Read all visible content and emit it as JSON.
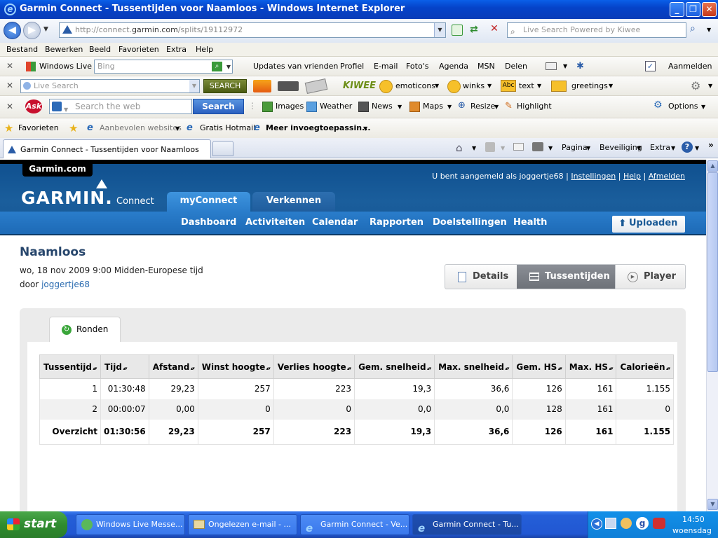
{
  "window": {
    "title": "Garmin Connect - Tussentijden voor Naamloos - Windows Internet Explorer"
  },
  "address": {
    "prefix": "http://connect.",
    "domain": "garmin.com",
    "path": "/splits/19112972",
    "search_placeholder": "Live Search Powered by Kiwee"
  },
  "menu": [
    "Bestand",
    "Bewerken",
    "Beeld",
    "Favorieten",
    "Extra",
    "Help"
  ],
  "toolbar_live": {
    "brand": "Windows Live",
    "search_placeholder": "Bing",
    "links": [
      "Updates van vrienden",
      "Profiel",
      "E-mail",
      "Foto's",
      "Agenda",
      "MSN",
      "Delen"
    ],
    "signin": "Aanmelden"
  },
  "toolbar_kiwee": {
    "search_placeholder": "Live Search",
    "search_button": "SEARCH",
    "brand": "KIWEE",
    "items": [
      "emoticons",
      "winks",
      "text",
      "greetings"
    ]
  },
  "toolbar_ask": {
    "brand": "Ask",
    "search_placeholder": "Search the web",
    "search_button": "Search",
    "items": [
      "Images",
      "Weather",
      "News",
      "Maps",
      "Resize",
      "Highlight"
    ],
    "options": "Options"
  },
  "favorites": {
    "label": "Favorieten",
    "items": [
      "Aanbevolen websites",
      "Gratis Hotmail",
      "Meer invoegtoepassin..."
    ]
  },
  "tab": {
    "label": "Garmin Connect - Tussentijden voor Naamloos"
  },
  "commandbar": [
    "Pagina",
    "Beveiliging",
    "Extra"
  ],
  "garmin": {
    "site_link": "Garmin.com",
    "status_prefix": "U bent aangemeld als joggertje68 |",
    "status_links": [
      "Instellingen",
      "Help",
      "Afmelden"
    ],
    "logo": "GARMIN.",
    "logo_sub": "Connect",
    "main_tabs": [
      "myConnect",
      "Verkennen"
    ],
    "subnav": [
      "Dashboard",
      "Activiteiten",
      "Calendar",
      "Rapporten",
      "Doelstellingen",
      "Health"
    ],
    "upload": "Uploaden"
  },
  "activity": {
    "title": "Naamloos",
    "date": "wo, 18 nov 2009 9:00 Midden-Europese tijd",
    "by_prefix": "door",
    "user": "joggertje68"
  },
  "view_tabs": [
    "Details",
    "Tussentijden",
    "Player"
  ],
  "splits": {
    "tab": "Ronden",
    "headers": [
      "Tussentijd",
      "Tijd",
      "Afstand",
      "Winst hoogte",
      "Verlies hoogte",
      "Gem. snelheid",
      "Max. snelheid",
      "Gem. HS",
      "Max. HS",
      "Calorieën"
    ],
    "rows": [
      [
        "1",
        "01:30:48",
        "29,23",
        "257",
        "223",
        "19,3",
        "36,6",
        "126",
        "161",
        "1.155"
      ],
      [
        "2",
        "00:00:07",
        "0,00",
        "0",
        "0",
        "0,0",
        "0,0",
        "128",
        "161",
        "0"
      ]
    ],
    "total": [
      "Overzicht",
      "01:30:56",
      "29,23",
      "257",
      "223",
      "19,3",
      "36,6",
      "126",
      "161",
      "1.155"
    ]
  },
  "taskbar": {
    "start": "start",
    "tasks": [
      "Windows Live Messe...",
      "Ongelezen e-mail - ...",
      "Garmin Connect - Ve...",
      "Garmin Connect - Tu..."
    ],
    "time": "14:50",
    "day": "woensdag"
  },
  "colors": {
    "garmin_blue": "#1a5e9c",
    "subnav_blue": "#2a7dcb",
    "title_blue": "#27466c"
  }
}
